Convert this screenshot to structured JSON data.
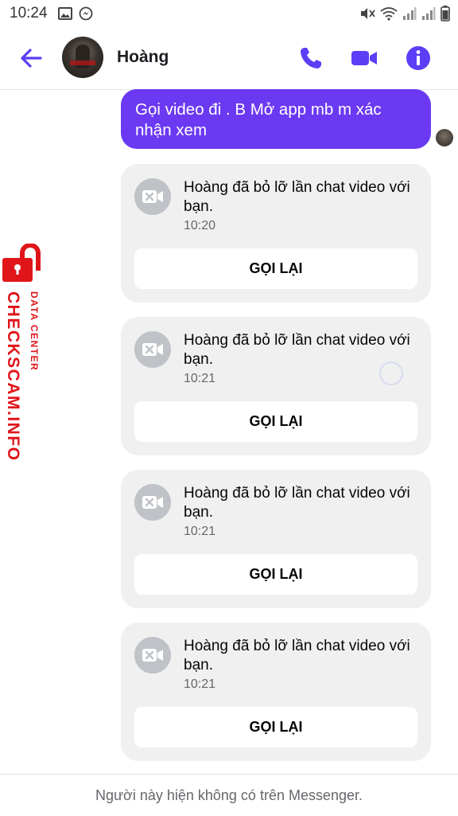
{
  "status_bar": {
    "time": "10:24",
    "left_icons": [
      "image-icon",
      "messenger-icon"
    ],
    "right_icons": [
      "mute-icon",
      "wifi-icon",
      "signal-icon",
      "signal-icon-2",
      "battery-icon"
    ]
  },
  "header": {
    "contact_name": "Hoàng",
    "actions": [
      "phone-icon",
      "video-icon",
      "info-icon"
    ],
    "accent_color": "#5b3ef5"
  },
  "messages": {
    "sent_text": "Gọi video đi . B Mở app mb m xác nhận xem",
    "sent_bubble_color": "#6b39f2",
    "missed_calls": [
      {
        "text": "Hoàng đã bỏ lỡ lần chat video với bạn.",
        "time": "10:20",
        "button": "GỌI LẠI"
      },
      {
        "text": "Hoàng đã bỏ lỡ lần chat video với bạn.",
        "time": "10:21",
        "button": "GỌI LẠI"
      },
      {
        "text": "Hoàng đã bỏ lỡ lần chat video với bạn.",
        "time": "10:21",
        "button": "GỌI LẠI"
      },
      {
        "text": "Hoàng đã bỏ lỡ lần chat video với bạn.",
        "time": "10:21",
        "button": "GỌI LẠI"
      }
    ]
  },
  "watermark": {
    "line1": "DATA CENTER",
    "line2": "CHECKSCAM.INFO",
    "color": "#e0151b"
  },
  "footer": {
    "notice": "Người này hiện không có trên Messenger."
  }
}
